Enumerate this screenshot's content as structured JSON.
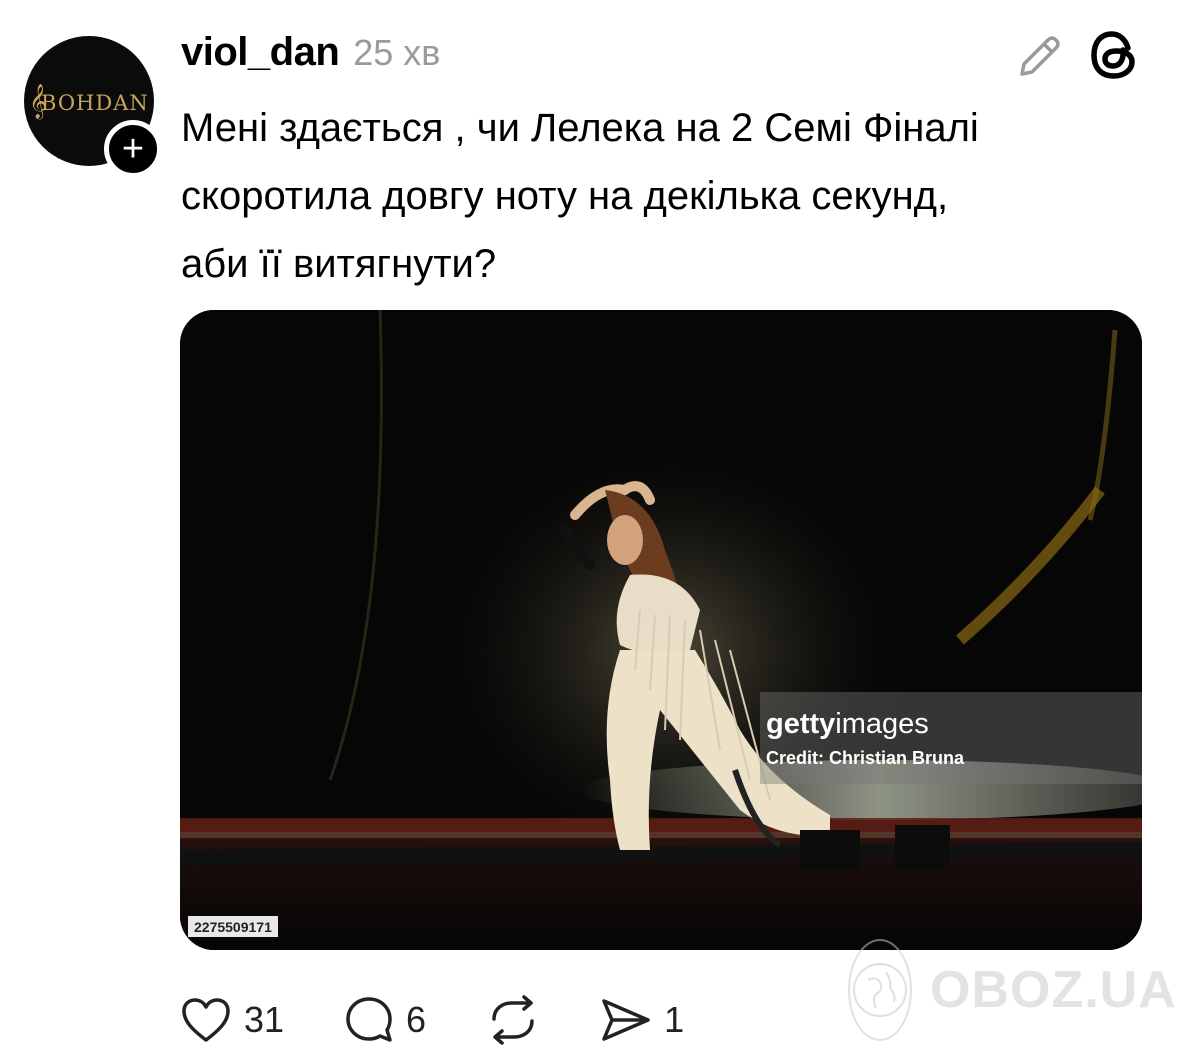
{
  "post": {
    "avatar_text": "BOHDAN",
    "follow_label": "+",
    "username": "viol_dan",
    "timestamp": "25 хв",
    "text_lines": [
      "Мені здається , чи Лелека на 2 Семі Фіналі",
      "скоротила довгу ноту на декілька секунд,",
      "аби  її витягнути?"
    ],
    "image": {
      "getty_logo_bold": "getty",
      "getty_logo_rest": "images",
      "credit": "Credit: Christian Bruna",
      "image_id": "2275509171"
    }
  },
  "actions": {
    "likes": "31",
    "comments": "6",
    "shares": "1"
  },
  "watermark": {
    "text": "OBOZ.UA"
  },
  "colors": {
    "text": "#000000",
    "muted": "#9a9a9a",
    "avatar_gold": "#c9a45c"
  }
}
